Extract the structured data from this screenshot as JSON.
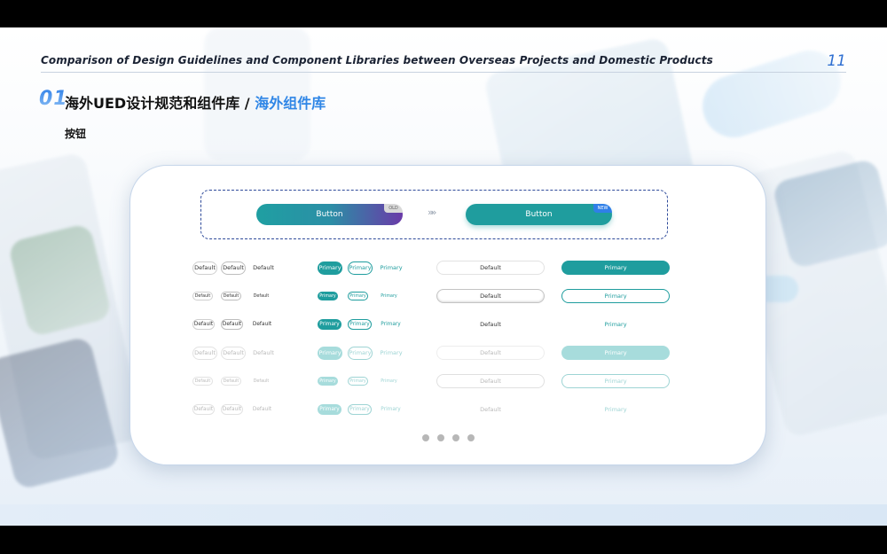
{
  "header": {
    "title": "Comparison of Design Guidelines and Component Libraries between Overseas Projects and Domestic Products",
    "page_number": "11"
  },
  "section": {
    "number": "01",
    "title": "海外UED设计规范和组件库 / ",
    "highlight": "海外组件库",
    "subheading": "按钮"
  },
  "comparison": {
    "old_button_label": "Button",
    "old_tag": "OLD",
    "arrow": "»»",
    "new_button_label": "Button",
    "new_tag": "NEW"
  },
  "button_grid": {
    "default_label": "Default",
    "primary_label": "Primary",
    "rows": [
      {
        "size": "large",
        "state": "normal"
      },
      {
        "size": "small",
        "state": "normal"
      },
      {
        "size": "medium",
        "state": "normal"
      },
      {
        "size": "large",
        "state": "disabled"
      },
      {
        "size": "small",
        "state": "disabled"
      },
      {
        "size": "medium",
        "state": "disabled"
      }
    ]
  },
  "pagination": {
    "count": 4
  },
  "colors": {
    "primary_teal": "#1f9d9e",
    "accent_blue": "#2f86e6",
    "disabled_teal": "#a7dcdc"
  }
}
